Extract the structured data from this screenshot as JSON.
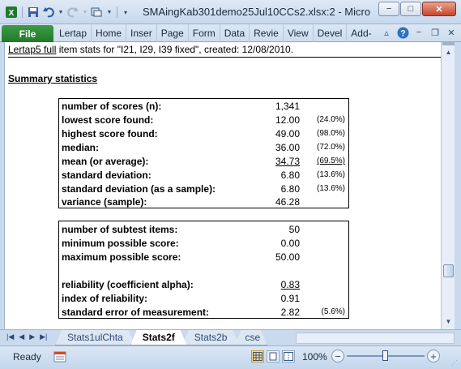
{
  "window": {
    "title": "SMAingKab301demo25Jul10CCs2.xlsx:2  -  Micro",
    "min_label": "−",
    "max_label": "□",
    "close_label": "✕"
  },
  "ribbon": {
    "file_label": "File",
    "tabs": [
      "Lertap",
      "Home",
      "Inser",
      "Page",
      "Form",
      "Data",
      "Revie",
      "View",
      "Devel",
      "Add-I"
    ]
  },
  "sheet": {
    "header_prefix": "Lertap5 full",
    "header_rest": " item stats for \"I21, I29, I39 fixed\", created: 12/08/2010.",
    "summary_title": "Summary statistics",
    "box1": [
      {
        "label": "number of scores (n):",
        "value": "1,341",
        "pct": ""
      },
      {
        "label": "lowest score found:",
        "value": "12.00",
        "pct": "(24.0%)"
      },
      {
        "label": "highest score found:",
        "value": "49.00",
        "pct": "(98.0%)"
      },
      {
        "label": "median:",
        "value": "36.00",
        "pct": "(72.0%)"
      },
      {
        "label": "mean (or average):",
        "value": "34.73",
        "pct": "(69.5%)"
      },
      {
        "label": "standard deviation:",
        "value": "6.80",
        "pct": "(13.6%)"
      },
      {
        "label": "standard deviation (as a sample):",
        "value": "6.80",
        "pct": "(13.6%)"
      },
      {
        "label": "variance (sample):",
        "value": "46.28",
        "pct": ""
      }
    ],
    "box2": [
      {
        "label": "number of subtest items:",
        "value": "50",
        "pct": ""
      },
      {
        "label": "minimum possible score:",
        "value": "0.00",
        "pct": ""
      },
      {
        "label": "maximum possible score:",
        "value": "50.00",
        "pct": ""
      },
      {
        "label": "reliability (coefficient alpha):",
        "value": "0.83",
        "pct": ""
      },
      {
        "label": "index of reliability:",
        "value": "0.91",
        "pct": ""
      },
      {
        "label": "standard error of measurement:",
        "value": "2.82",
        "pct": "(5.6%)"
      }
    ]
  },
  "sheet_tabs": [
    "Stats1ulChta",
    "Stats2f",
    "Stats2b",
    "cse"
  ],
  "active_sheet_tab": "Stats2f",
  "status": {
    "ready": "Ready",
    "zoom": "100%",
    "zoom_minus": "−",
    "zoom_plus": "+"
  }
}
